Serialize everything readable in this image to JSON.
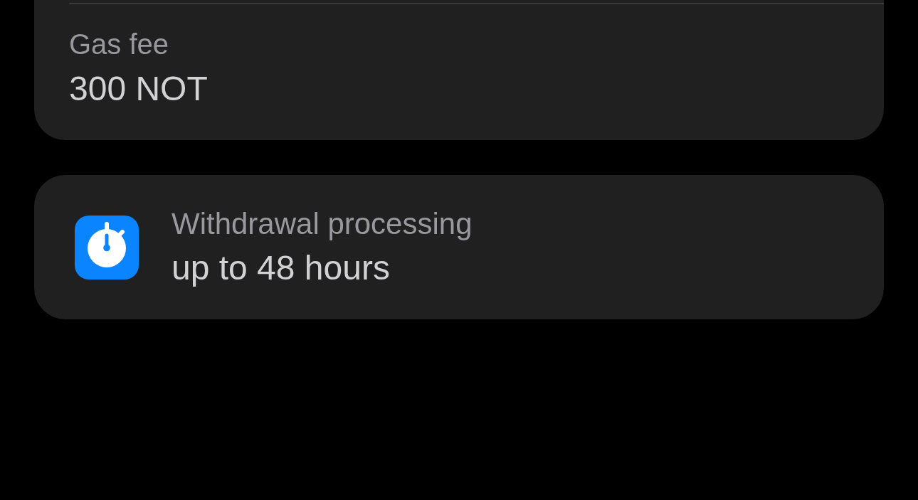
{
  "fee_card": {
    "label": "Gas fee",
    "value": "300 NOT"
  },
  "processing_card": {
    "label": "Withdrawal processing",
    "value": "up to 48 hours"
  }
}
